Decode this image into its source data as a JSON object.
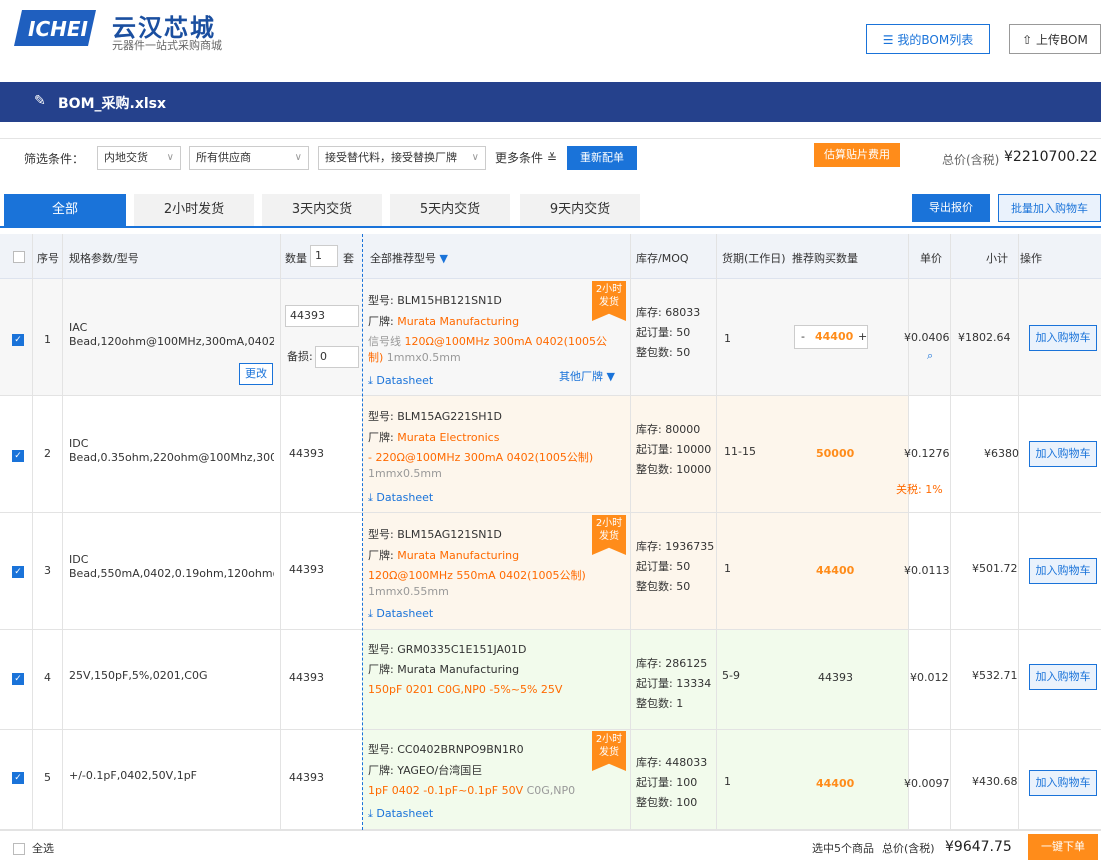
{
  "header": {
    "brand": "云汉芯城",
    "tagline": "元器件一站式采购商城",
    "bom_list_label": "我的BOM列表",
    "upload_label": "上传BOM"
  },
  "titlebar": {
    "filename": "BOM_采购.xlsx"
  },
  "filters": {
    "label": "筛选条件：",
    "delivery": "内地交货",
    "supplier": "所有供应商",
    "substitute": "接受替代料，接受替换厂牌",
    "more": "更多条件",
    "rematch": "重新配单",
    "est_fee": "估算贴片费用",
    "total_label": "总价(含税)",
    "total_value": "¥2210700.22"
  },
  "tabs": [
    "全部",
    "2小时发货",
    "3天内交货",
    "5天内交货",
    "9天内交货"
  ],
  "actions": {
    "export": "导出报价",
    "batch_cart": "批量加入购物车"
  },
  "table_header": {
    "index": "序号",
    "spec": "规格参数/型号",
    "qty": "数量",
    "qty_value": "1",
    "set": "套",
    "recommend": "全部推荐型号",
    "stock": "库存/MOQ",
    "lead": "货期(工作日)",
    "suggest": "推荐购买数量",
    "price": "单价",
    "subtotal": "小计",
    "op": "操作"
  },
  "rows": [
    {
      "index": "1",
      "spec_line1": "IAC",
      "spec_line2": "Bead,120ohm@100MHz,300mA,0402",
      "change": "更改",
      "qty": "44393",
      "spare_label": "备损:",
      "spare": "0",
      "badge": "2小时发货",
      "model": "型号: BLM15HB121SN1D",
      "brand_label": "厂牌: ",
      "brand": "Murata Manufacturing",
      "desc_pre": "信号线 ",
      "desc_hl": "120Ω@100MHz 300mA 0402(1005公制)",
      "desc_post": " 1mmx0.5mm",
      "datasheet": "Datasheet",
      "other_brand": "其他厂牌",
      "stock": "库存: 68033",
      "moq": "起订量: 50",
      "pack": "整包数: 50",
      "lead": "1",
      "suggest": "44400",
      "price": "¥0.0406",
      "tariff": "",
      "subtotal": "¥1802.64",
      "cart": "加入购物车"
    },
    {
      "index": "2",
      "spec_line1": "IDC",
      "spec_line2": "Bead,0.35ohm,220ohm@100Mhz,300m...",
      "qty": "44393",
      "badge": "",
      "model": "型号: BLM15AG221SH1D",
      "brand_label": "厂牌: ",
      "brand": "Murata Electronics",
      "desc_pre": "",
      "desc_hl": "- 220Ω@100MHz 300mA 0402(1005公制)",
      "desc_post": " 1mmx0.5mm",
      "datasheet": "Datasheet",
      "stock": "库存: 80000",
      "moq": "起订量: 10000",
      "pack": "整包数: 10000",
      "lead": "11-15",
      "suggest": "50000",
      "price": "¥0.1276",
      "tariff": "关税: 1%",
      "subtotal": "¥6380",
      "cart": "加入购物车"
    },
    {
      "index": "3",
      "spec_line1": "IDC",
      "spec_line2": "Bead,550mA,0402,0.19ohm,120ohm@...",
      "qty": "44393",
      "badge": "2小时发货",
      "model": "型号: BLM15AG121SN1D",
      "brand_label": "厂牌: ",
      "brand": "Murata Manufacturing",
      "desc_pre": "",
      "desc_hl": "120Ω@100MHz 550mA 0402(1005公制)",
      "desc_post": " 1mmx0.55mm",
      "datasheet": "Datasheet",
      "stock": "库存: 1936735",
      "moq": "起订量: 50",
      "pack": "整包数: 50",
      "lead": "1",
      "suggest": "44400",
      "price": "¥0.0113",
      "tariff": "",
      "subtotal": "¥501.72",
      "cart": "加入购物车"
    },
    {
      "index": "4",
      "spec_line1": "25V,150pF,5%,0201,C0G",
      "spec_line2": "",
      "qty": "44393",
      "badge": "",
      "model": "型号: GRM0335C1E151JA01D",
      "brand_label": "厂牌: ",
      "brand": "Murata Manufacturing",
      "desc_pre": "",
      "desc_hl": "150pF 0201 C0G,NP0 -5%~5% 25V",
      "desc_post": "",
      "datasheet": "",
      "stock": "库存: 286125",
      "moq": "起订量: 13334",
      "pack": "整包数: 1",
      "lead": "5-9",
      "suggest": "44393",
      "price": "¥0.012",
      "tariff": "",
      "subtotal": "¥532.71",
      "cart": "加入购物车"
    },
    {
      "index": "5",
      "spec_line1": "+/-0.1pF,0402,50V,1pF",
      "spec_line2": "",
      "qty": "44393",
      "badge": "2小时发货",
      "model": "型号: CC0402BRNPO9BN1R0",
      "brand_label": "厂牌: ",
      "brand": "YAGEO/台湾国巨",
      "desc_pre": "",
      "desc_hl": "1pF 0402 -0.1pF~0.1pF 50V",
      "desc_post": " C0G,NP0",
      "datasheet": "Datasheet",
      "stock": "库存: 448033",
      "moq": "起订量: 100",
      "pack": "整包数: 100",
      "lead": "1",
      "suggest": "44400",
      "price": "¥0.0097",
      "tariff": "",
      "subtotal": "¥430.68",
      "cart": "加入购物车"
    }
  ],
  "footer": {
    "select_all": "全选",
    "selected": "选中5个商品",
    "total_label": "总价(含税)",
    "total": "¥9647.75",
    "order": "一键下单"
  },
  "colors": {
    "primary": "#1a73d9",
    "navy": "#25418c",
    "orange": "#ff8c1a"
  }
}
